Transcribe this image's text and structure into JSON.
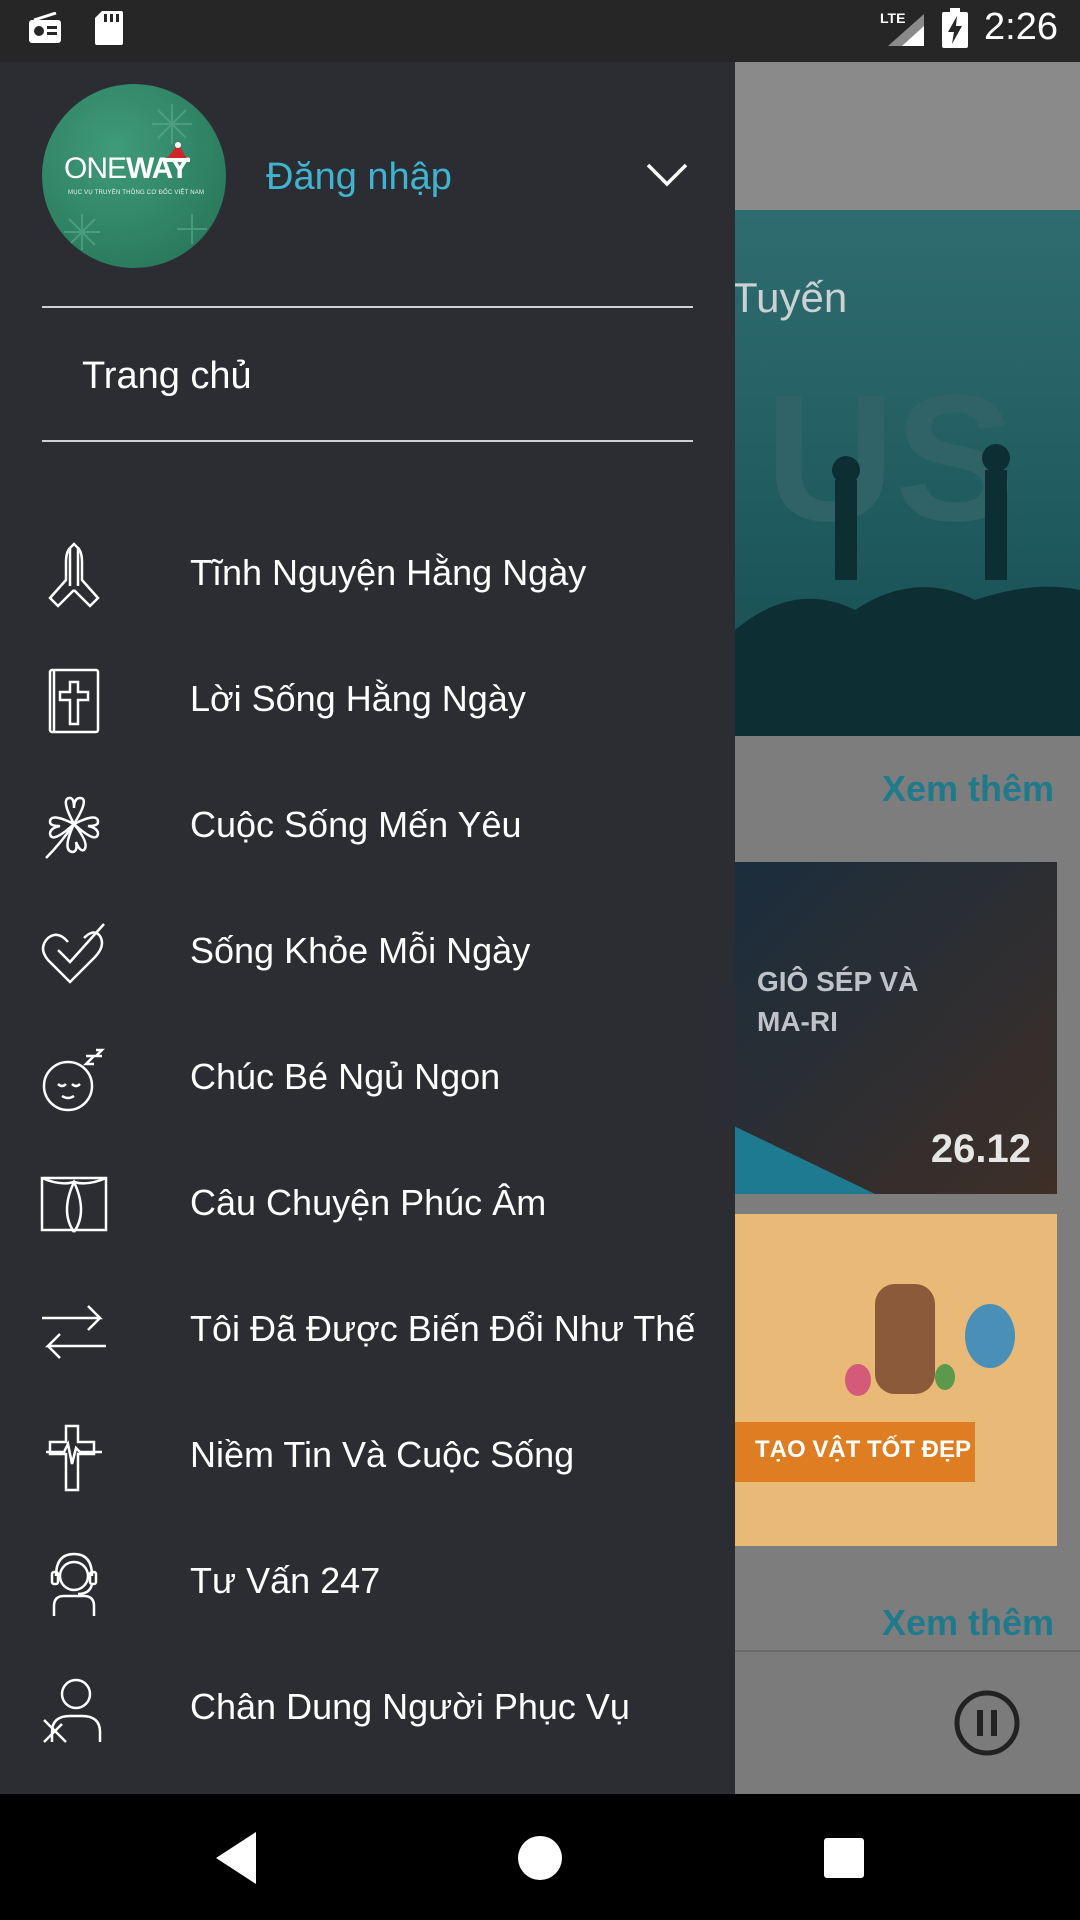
{
  "status_bar": {
    "time": "2:26",
    "network": "LTE",
    "icons": [
      "radio-icon",
      "sd-card-icon",
      "signal-icon",
      "battery-charging-icon"
    ]
  },
  "drawer": {
    "profile": {
      "logo_text_one": "ONE",
      "logo_text_way": "WAY",
      "logo_subtitle": "MỤC VỤ TRUYỀN THÔNG CƠ ĐỐC VIỆT NAM",
      "login_label": "Đăng nhập"
    },
    "home_label": "Trang chủ",
    "items": [
      {
        "label": "Tĩnh Nguyện Hằng Ngày",
        "icon": "praying-hands-icon"
      },
      {
        "label": "Lời Sống Hằng Ngày",
        "icon": "bible-icon"
      },
      {
        "label": "Cuộc Sống Mến Yêu",
        "icon": "clover-icon"
      },
      {
        "label": "Sống Khỏe Mỗi Ngày",
        "icon": "heart-check-icon"
      },
      {
        "label": "Chúc Bé Ngủ Ngon",
        "icon": "sleeping-baby-icon"
      },
      {
        "label": "Câu Chuyện Phúc Âm",
        "icon": "open-book-icon"
      },
      {
        "label": "Tôi Đã Được Biến Đổi Như Thế",
        "icon": "exchange-arrows-icon"
      },
      {
        "label": "Niềm Tin Và Cuộc Sống",
        "icon": "cross-heartbeat-icon"
      },
      {
        "label": "Tư Vấn 247",
        "icon": "headset-person-icon"
      },
      {
        "label": "Chân Dung Người Phục Vụ",
        "icon": "person-portrait-icon"
      }
    ]
  },
  "background": {
    "hero_text": "Tuyến",
    "see_more_1": "Xem thêm",
    "card1_title": "GIÔ SÉP VÀ MA-RI",
    "card1_date": "26.12",
    "card2_banner": "TẠO VẬT TỐT ĐẸP",
    "see_more_2": "Xem thêm"
  },
  "colors": {
    "drawer_bg": "#2b2d33",
    "accent": "#3fb3cf",
    "link": "#1f7a8c"
  }
}
